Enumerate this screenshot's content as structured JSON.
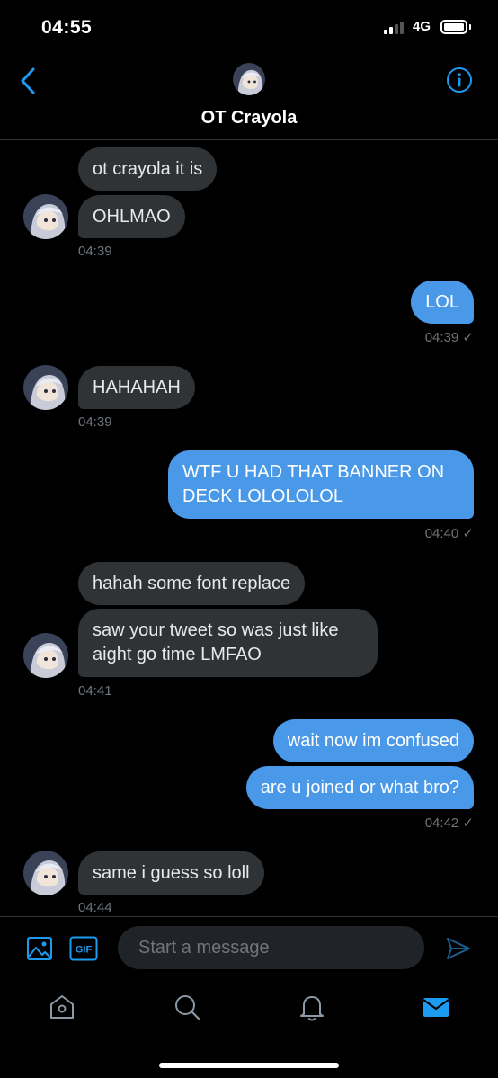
{
  "status_bar": {
    "time": "04:55",
    "network": "4G"
  },
  "header": {
    "title": "OT Crayola",
    "back_icon": "chevron-left-icon",
    "info_icon": "info-icon",
    "accent": "#1d9bf0"
  },
  "messages": [
    {
      "dir": "in",
      "text": "ot crayola it is"
    },
    {
      "dir": "in",
      "text": "OHLMAO",
      "time": "04:39"
    },
    {
      "dir": "out",
      "text": "LOL",
      "time": "04:39 ✓"
    },
    {
      "dir": "in",
      "text": "HAHAHAH",
      "time": "04:39"
    },
    {
      "dir": "out",
      "text": "WTF U HAD THAT BANNER ON DECK LOLOLOLOL",
      "time": "04:40 ✓"
    },
    {
      "dir": "in",
      "text": "hahah some font replace"
    },
    {
      "dir": "in",
      "text": "saw your tweet so was just like aight go time LMFAO",
      "time": "04:41"
    },
    {
      "dir": "out",
      "text": "wait now im confused"
    },
    {
      "dir": "out",
      "text": "are u joined or what bro?",
      "time": "04:42 ✓"
    },
    {
      "dir": "in",
      "text": "same i guess so loll",
      "time": "04:44"
    }
  ],
  "compose": {
    "placeholder": "Start a message",
    "gif_label": "GIF"
  },
  "tabs": [
    "home-icon",
    "search-icon",
    "bell-icon",
    "mail-icon"
  ],
  "colors": {
    "outgoing_bubble": "#4a99e9",
    "incoming_bubble": "#2f3336",
    "timestamp": "#71767b"
  }
}
